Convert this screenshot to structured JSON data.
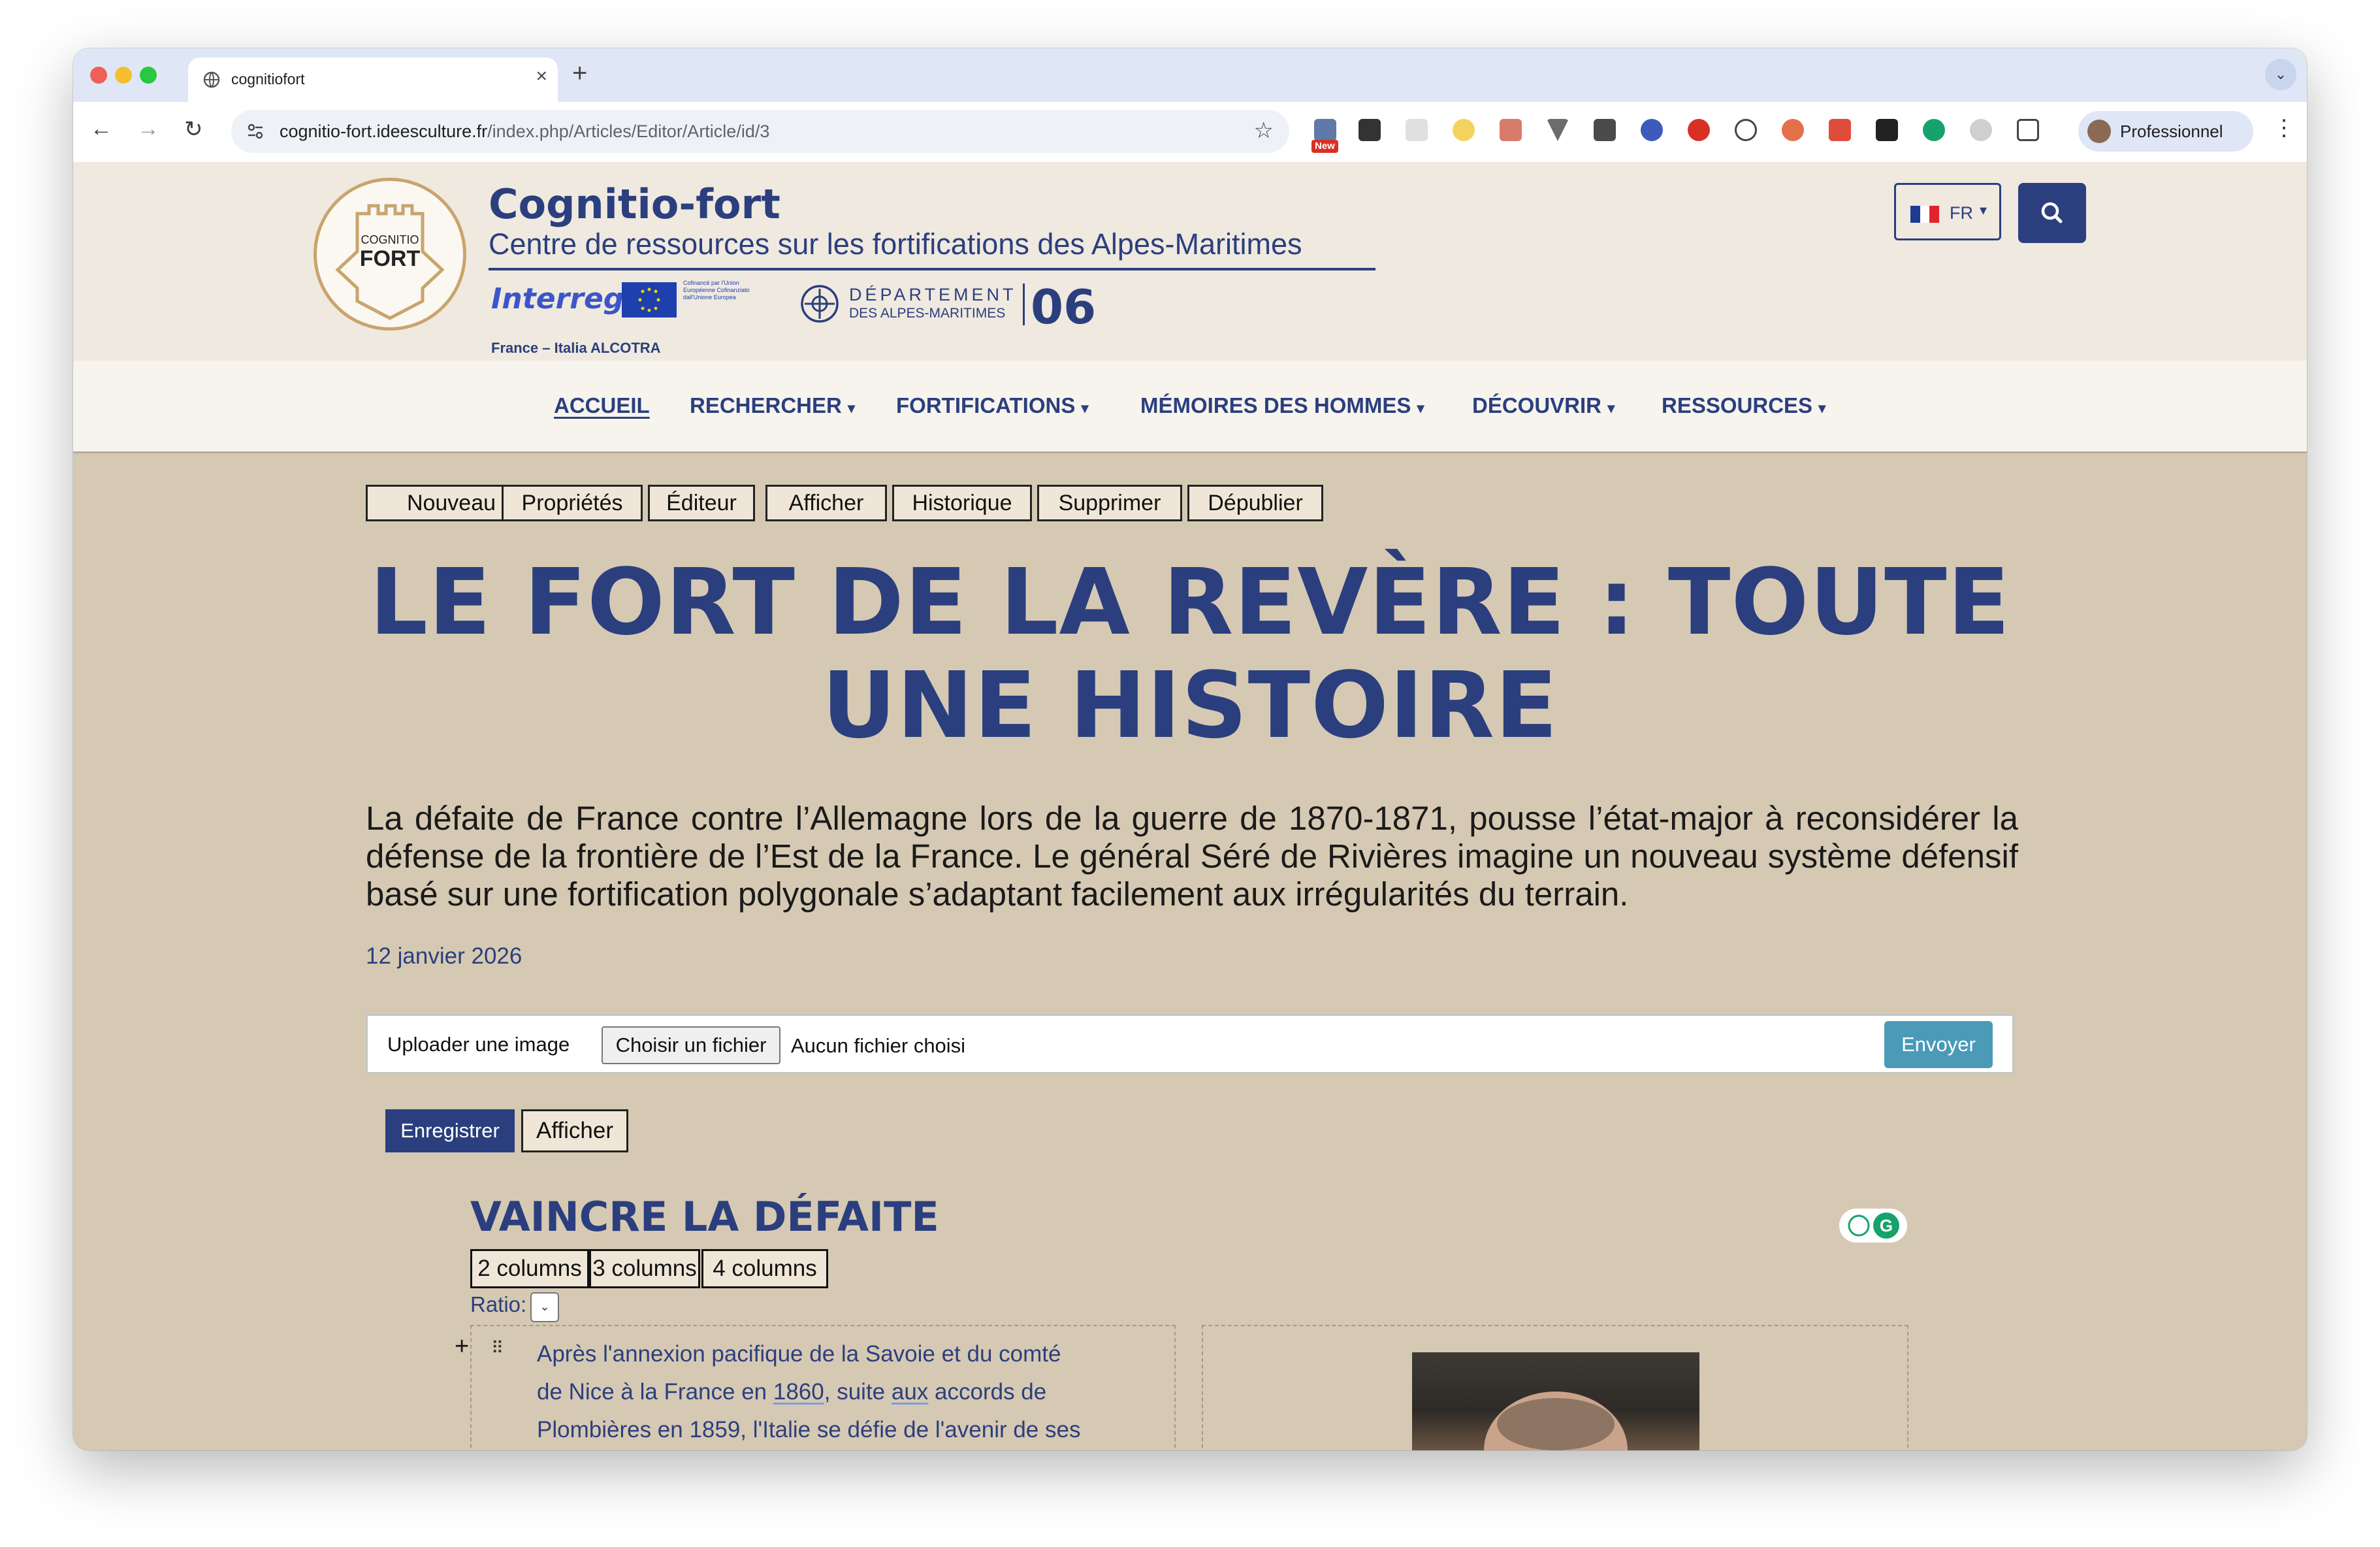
{
  "browser": {
    "tab_title": "cognitiofort",
    "url_host": "cognitio-fort.ideesculture.fr",
    "url_path": "/index.php/Articles/Editor/Article/id/3",
    "new_badge": "New",
    "profile_name": "Professionnel"
  },
  "site": {
    "title": "Cognitio-fort",
    "subtitle": "Centre de ressources sur les fortifications des Alpes-Maritimes",
    "logo_line1": "COGNITIO",
    "logo_line2": "FORT",
    "interreg": "Interreg",
    "eu_text": "Cofinancé par l'Union Européenne Cofinanziato dall'Unione Europea",
    "alcotra": "France – Italia ALCOTRA",
    "dept_line1": "DÉPARTEMENT",
    "dept_line2": "DES ALPES-MARITIMES",
    "dept_number": "06",
    "lang": "FR"
  },
  "nav": {
    "items": [
      {
        "label": "ACCUEIL"
      },
      {
        "label": "RECHERCHER"
      },
      {
        "label": "FORTIFICATIONS"
      },
      {
        "label": "MÉMOIRES DES HOMMES"
      },
      {
        "label": "DÉCOUVRIR"
      },
      {
        "label": "RESSOURCES"
      }
    ]
  },
  "admin": {
    "buttons": [
      "Nouveau",
      "Propriétés",
      "Éditeur",
      "Afficher",
      "Historique",
      "Supprimer",
      "Dépublier"
    ]
  },
  "article": {
    "title": "LE FORT DE LA REVÈRE : TOUTE UNE HISTOIRE",
    "intro": "La défaite de France contre l’Allemagne lors de la guerre de 1870-1871, pousse l’état-major à reconsidérer la défense de la frontière de l’Est de la France. Le général Séré de Rivières imagine un nouveau système défensif basé sur une fortification polygonale s’adaptant facilement aux irrégularités du terrain.",
    "date": "12 janvier 2026"
  },
  "upload": {
    "label": "Uploader une image",
    "choose_file": "Choisir un fichier",
    "no_file": "Aucun fichier choisi",
    "send": "Envoyer"
  },
  "editor": {
    "save": "Enregistrer",
    "view": "Afficher",
    "section_title": "VAINCRE LA DÉFAITE",
    "columns": [
      "2 columns",
      "3 columns",
      "4 columns"
    ],
    "ratio_label": "Ratio:",
    "body_line1": "Après l'annexion pacifique de la Savoie et du comté",
    "body_line2a": "de Nice à la France en ",
    "body_line2b": "1860",
    "body_line2c": ", suite ",
    "body_line2d": "aux",
    "body_line2e": " accords de",
    "body_line3": "Plombières en 1859, l'Italie se défie de l'avenir de ses"
  },
  "colors": {
    "brand_blue": "#2b3f7e",
    "header_bg": "#efe9df",
    "content_bg": "#d6c9b3",
    "send_button": "#4a9ab8",
    "logo_gold": "#c9a46e"
  }
}
